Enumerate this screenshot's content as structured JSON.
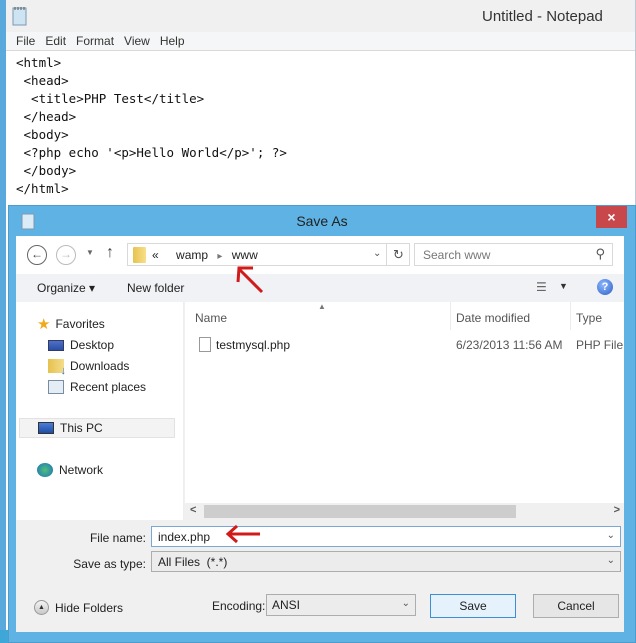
{
  "notepad": {
    "title": "Untitled - Notepad",
    "menu": [
      "File",
      "Edit",
      "Format",
      "View",
      "Help"
    ],
    "content": "<html>\n <head>\n  <title>PHP Test</title>\n </head>\n <body>\n <?php echo '<p>Hello World</p>'; ?>\n </body>\n</html>"
  },
  "dialog": {
    "title": "Save As",
    "close_label": "×",
    "address": {
      "overflow": "«",
      "crumbs": [
        "wamp",
        "www"
      ]
    },
    "search": {
      "placeholder": "Search www"
    },
    "toolbar": {
      "organize": "Organize ▾",
      "new_folder": "New folder",
      "help": "?"
    },
    "nav": {
      "favorites": "Favorites",
      "desktop": "Desktop",
      "downloads": "Downloads",
      "recent": "Recent places",
      "this_pc": "This PC",
      "network": "Network"
    },
    "columns": {
      "name": "Name",
      "date": "Date modified",
      "type": "Type"
    },
    "files": [
      {
        "name": "testmysql.php",
        "date": "6/23/2013 11:56 AM",
        "type": "PHP File"
      }
    ],
    "form": {
      "file_name_label": "File name:",
      "file_name_value": "index.php",
      "save_type_label": "Save as type:",
      "save_type_value": "All Files  (*.*)"
    },
    "footer": {
      "hide_folders": "Hide Folders",
      "encoding_label": "Encoding:",
      "encoding_value": "ANSI",
      "save": "Save",
      "cancel": "Cancel"
    }
  },
  "annotations": {
    "arrow_color": "#d11a1a"
  }
}
